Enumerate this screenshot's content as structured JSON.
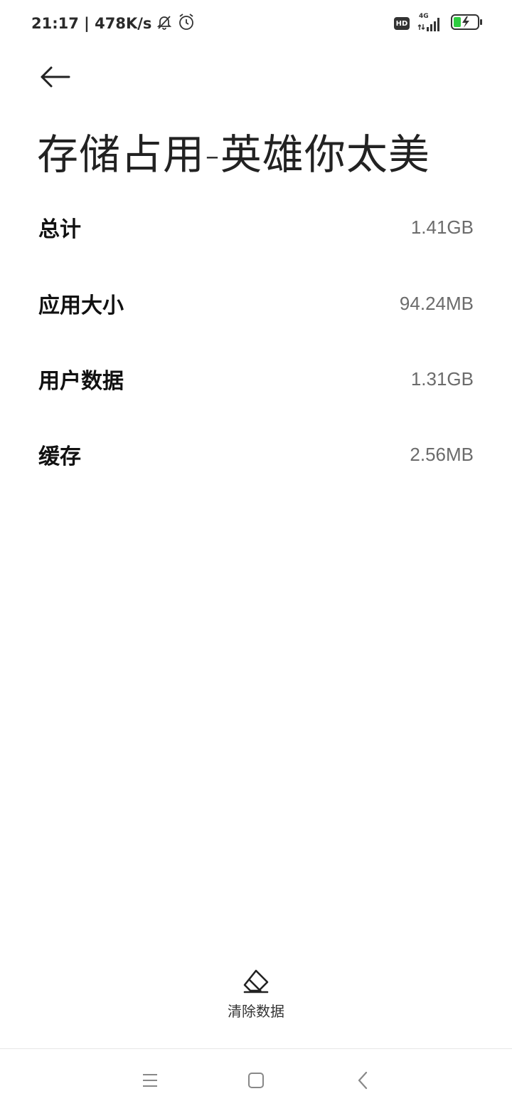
{
  "status_bar": {
    "time_speed": "21:17 | 478K/s",
    "hd_badge": "HD",
    "network": "4G",
    "icons": [
      "muted-bell-icon",
      "alarm-icon",
      "hd-icon",
      "signal-icon",
      "battery-charging-icon"
    ],
    "battery_color": "#2ecc40"
  },
  "header": {
    "back_icon": "arrow-left-icon",
    "title": "存储占用-英雄你太美"
  },
  "storage_items": [
    {
      "label": "总计",
      "value": "1.41GB"
    },
    {
      "label": "应用大小",
      "value": "94.24MB"
    },
    {
      "label": "用户数据",
      "value": "1.31GB"
    },
    {
      "label": "缓存",
      "value": "2.56MB"
    }
  ],
  "actions": {
    "clear_icon": "eraser-icon",
    "clear_label": "清除数据"
  },
  "nav_bar": {
    "buttons": [
      "menu-icon",
      "home-icon",
      "back-icon"
    ]
  }
}
